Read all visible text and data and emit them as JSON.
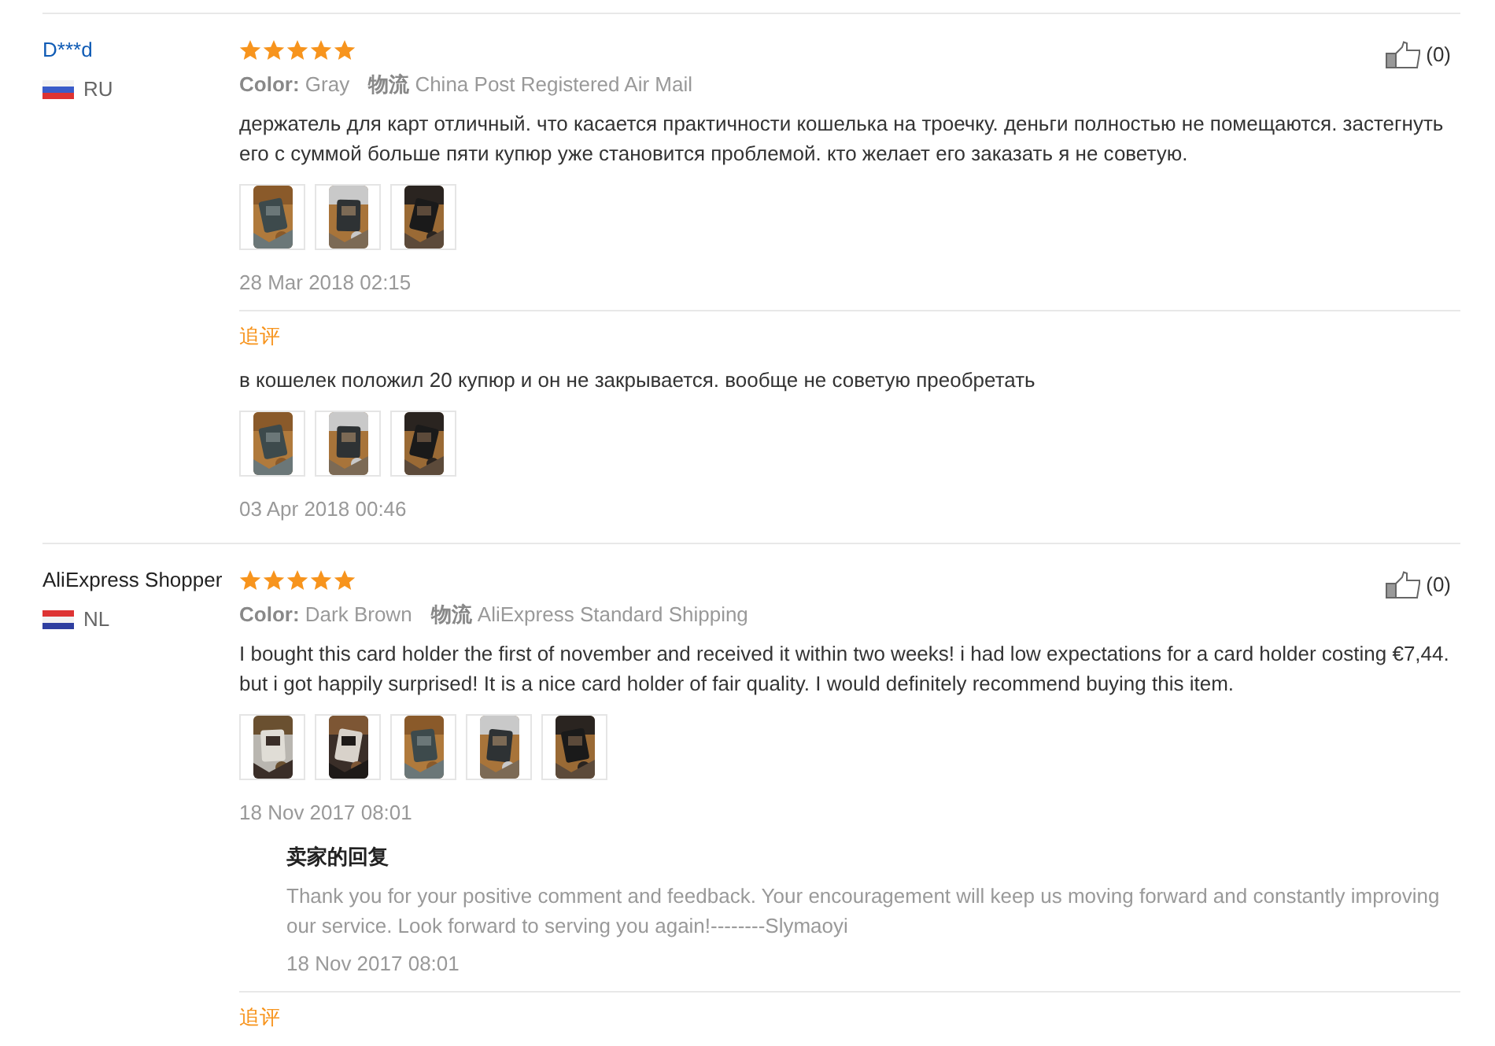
{
  "reviews": [
    {
      "author": "D***d",
      "author_link": true,
      "flag": {
        "kind": "russia"
      },
      "country": "RU",
      "stars": 5,
      "helpful": "(0)",
      "color_label": "Color:",
      "color_value": "Gray",
      "shipping_label": "物流",
      "shipping": "China Post Registered Air Mail",
      "text": "держатель для карт отличный. что касается практичности кошелька на троечку. деньги полностью не помещаются. застегнуть его с суммой больше пяти купюр уже становится проблемой. кто желает его заказать я не советую.",
      "photos": [
        {
          "kind": "picture"
        },
        {
          "kind": "picture"
        },
        {
          "kind": "picture"
        }
      ],
      "date": "28 Mar 2018 02:15",
      "followups": [
        {
          "label": "追评",
          "text": "в кошелек положил 20 купюр и он не закрывается. вообще не советую преобретать",
          "photos": [
            {
              "kind": "picture"
            },
            {
              "kind": "picture"
            },
            {
              "kind": "picture"
            }
          ],
          "date": "03 Apr 2018 00:46"
        }
      ]
    },
    {
      "author": "AliExpress Shopper",
      "author_link": false,
      "flag": {
        "kind": "netherlands"
      },
      "country": "NL",
      "stars": 5,
      "helpful": "(0)",
      "color_label": "Color:",
      "color_value": "Dark Brown",
      "shipping_label": "物流",
      "shipping": "AliExpress Standard Shipping",
      "text": "I bought this card holder the first of november and received it within two weeks! i had low expectations for a card holder costing €7,44. but i got happily surprised! It is a nice card holder of fair quality. I would definitely recommend buying this item.",
      "photos": [
        {
          "kind": "picture"
        },
        {
          "kind": "picture"
        },
        {
          "kind": "picture"
        },
        {
          "kind": "picture"
        },
        {
          "kind": "picture"
        }
      ],
      "date": "18 Nov 2017 08:01",
      "seller_reply": {
        "title": "卖家的回复",
        "text": "Thank you for your positive comment and feedback. Your encouragement will keep us moving forward and constantly improving our service. Look forward to serving you again!--------Slymaoyi",
        "date": "18 Nov 2017 08:01"
      },
      "followups": [
        {
          "label": "追评"
        }
      ]
    }
  ]
}
